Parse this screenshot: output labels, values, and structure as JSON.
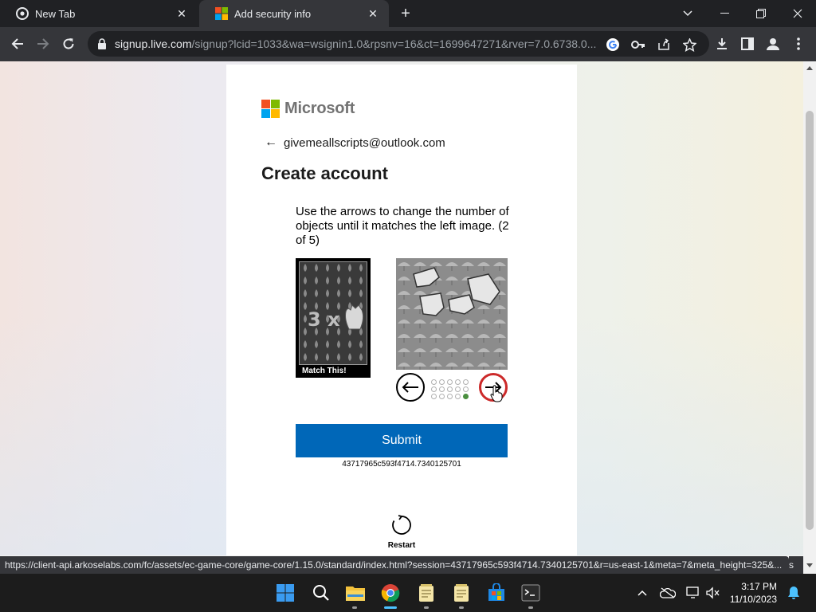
{
  "browser": {
    "tabs": [
      {
        "title": "New Tab",
        "active": false,
        "icon": "chrome-icon"
      },
      {
        "title": "Add security info",
        "active": true,
        "icon": "microsoft-favicon"
      }
    ],
    "url_host": "signup.live.com",
    "url_rest": "/signup?lcid=1033&wa=wsignin1.0&rpsnv=16&ct=1699647271&rver=7.0.6738.0...",
    "status_url": "https://client-api.arkoselabs.com/fc/assets/ec-game-core/game-core/1.15.0/standard/index.html?session=43717965c593f4714.7340125701&r=us-east-1&meta=7&meta_height=325&...",
    "status_tail": "s"
  },
  "page": {
    "brand": "Microsoft",
    "brand_colors": [
      "#f25022",
      "#7fba00",
      "#00a4ef",
      "#ffb900"
    ],
    "identity": "givemeallscripts@outlook.com",
    "heading": "Create account",
    "puzzle": {
      "instruction": "Use the arrows to change the number of objects until it matches the left image. (2 of 5)",
      "match_text": "3 x",
      "match_label": "Match This!",
      "dots_total": 15,
      "dot_active_index": 14,
      "submit_label": "Submit",
      "session_id": "43717965c593f4714.7340125701",
      "restart_label": "Restart"
    }
  },
  "taskbar": {
    "time": "3:17 PM",
    "date": "11/10/2023",
    "apps": [
      "start-icon",
      "search-icon",
      "file-explorer-icon",
      "chrome-icon",
      "notepad-icon",
      "notepad-icon",
      "store-icon",
      "terminal-icon"
    ]
  },
  "colors": {
    "accent": "#0067b8",
    "dot_active": "#4a8f3f",
    "right_arrow_ring": "#cc2a2a"
  }
}
